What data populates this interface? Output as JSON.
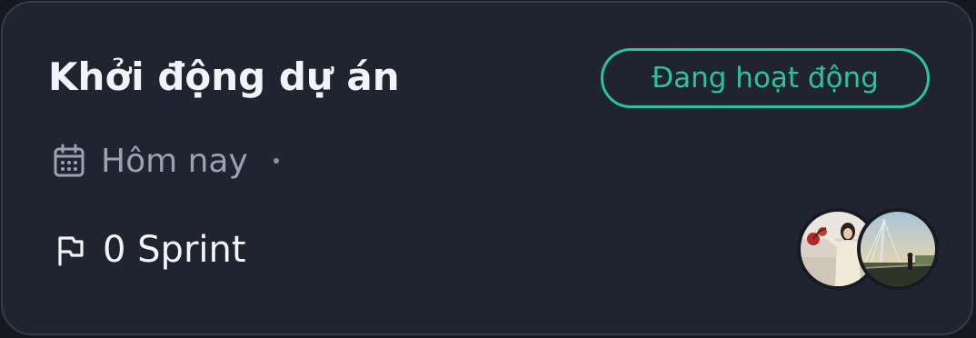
{
  "project": {
    "title": "Khởi động dự án",
    "status": "Đang hoạt động",
    "date": "Hôm nay",
    "sprint": "0 Sprint"
  },
  "icons": {
    "date": "calendar-icon",
    "sprint": "flag-icon"
  },
  "members": [
    {
      "name": "member-avatar-1"
    },
    {
      "name": "member-avatar-2"
    }
  ],
  "colors": {
    "card_background": "#1f2430",
    "accent": "#2cc39a",
    "muted_text": "#9aa1b3",
    "title_text": "#f3f4f7"
  }
}
